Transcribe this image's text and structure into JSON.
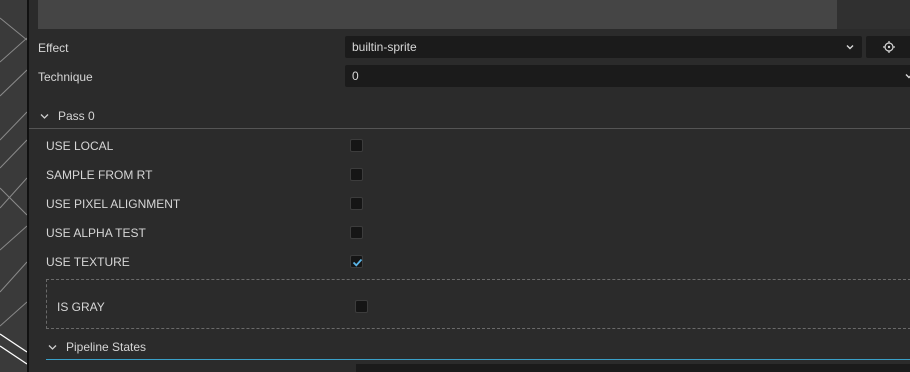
{
  "effect": {
    "label": "Effect",
    "value": "builtin-sprite",
    "locate_icon": "crosshair-icon"
  },
  "technique": {
    "label": "Technique",
    "value": "0"
  },
  "pass": {
    "title": "Pass 0",
    "defines": [
      {
        "label": "USE LOCAL",
        "checked": false
      },
      {
        "label": "SAMPLE FROM RT",
        "checked": false
      },
      {
        "label": "USE PIXEL ALIGNMENT",
        "checked": false
      },
      {
        "label": "USE ALPHA TEST",
        "checked": false
      },
      {
        "label": "USE TEXTURE",
        "checked": true
      }
    ],
    "sub_defines": [
      {
        "label": "IS GRAY",
        "checked": false
      }
    ]
  },
  "pipeline": {
    "title": "Pipeline States"
  },
  "colors": {
    "accent": "#3aa0c8",
    "checkmark": "#5ab4e6"
  }
}
